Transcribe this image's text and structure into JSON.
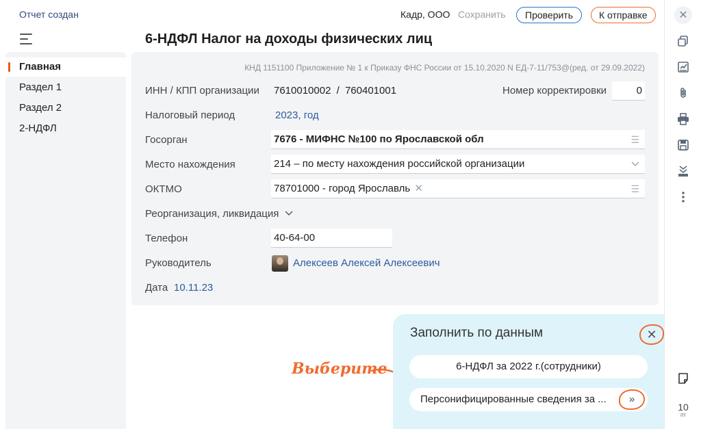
{
  "topbar": {
    "status": "Отчет создан",
    "org": "Кадр, ООО",
    "save_label": "Сохранить",
    "check_label": "Проверить",
    "send_label": "К отправке"
  },
  "sidebar": {
    "items": [
      {
        "label": "Главная",
        "active": true
      },
      {
        "label": "Раздел 1",
        "active": false
      },
      {
        "label": "Раздел 2",
        "active": false
      },
      {
        "label": "2-НДФЛ",
        "active": false
      }
    ]
  },
  "document": {
    "title": "6-НДФЛ Налог на доходы физических лиц",
    "knd": "КНД 1151100 Приложение № 1 к Приказу ФНС России от 15.10.2020 N ЕД-7-11/753@(ред. от 29.09.2022)",
    "inn_label": "ИНН / КПП организации",
    "inn_value": "7610010002",
    "inn_sep": "/",
    "kpp_value": "760401001",
    "corr_label": "Номер корректировки",
    "corr_value": "0",
    "period_label": "Налоговый период",
    "period_value": "2023, год",
    "gosorgan_label": "Госорган",
    "gosorgan_value": "7676 - МИФНС №100 по Ярославской обл",
    "place_label": "Место нахождения",
    "place_value": "214 – по месту нахождения российской организации",
    "oktmo_label": "ОКТМО",
    "oktmo_value": "78701000 - город Ярославль",
    "reorg_label": "Реорганизация, ликвидация",
    "phone_label": "Телефон",
    "phone_value": "40-64-00",
    "head_label": "Руководитель",
    "head_value": "Алексеев Алексей Алексеевич",
    "date_label": "Дата",
    "date_value": "10.11.23"
  },
  "fill_panel": {
    "title": "Заполнить по данным",
    "option1": "6-НДФЛ за 2022 г.(сотрудники)",
    "option2": "Персонифицированные сведения за ...",
    "more_label": "»"
  },
  "hint": {
    "text": "Выберите"
  },
  "rail": {
    "date_num": "10",
    "date_day": "пт"
  },
  "colors": {
    "accent": "#ef6c2d",
    "link": "#2d5b9c",
    "panel_bg": "#f2f4f6",
    "fill_bg": "#dff4fa"
  },
  "icons": [
    "close-icon",
    "copy-icon",
    "signature-icon",
    "attach-icon",
    "print-icon",
    "save-icon",
    "download-icon",
    "more-icon",
    "note-icon",
    "menu-icon",
    "chevron-down-icon",
    "list-icon",
    "clear-icon"
  ]
}
